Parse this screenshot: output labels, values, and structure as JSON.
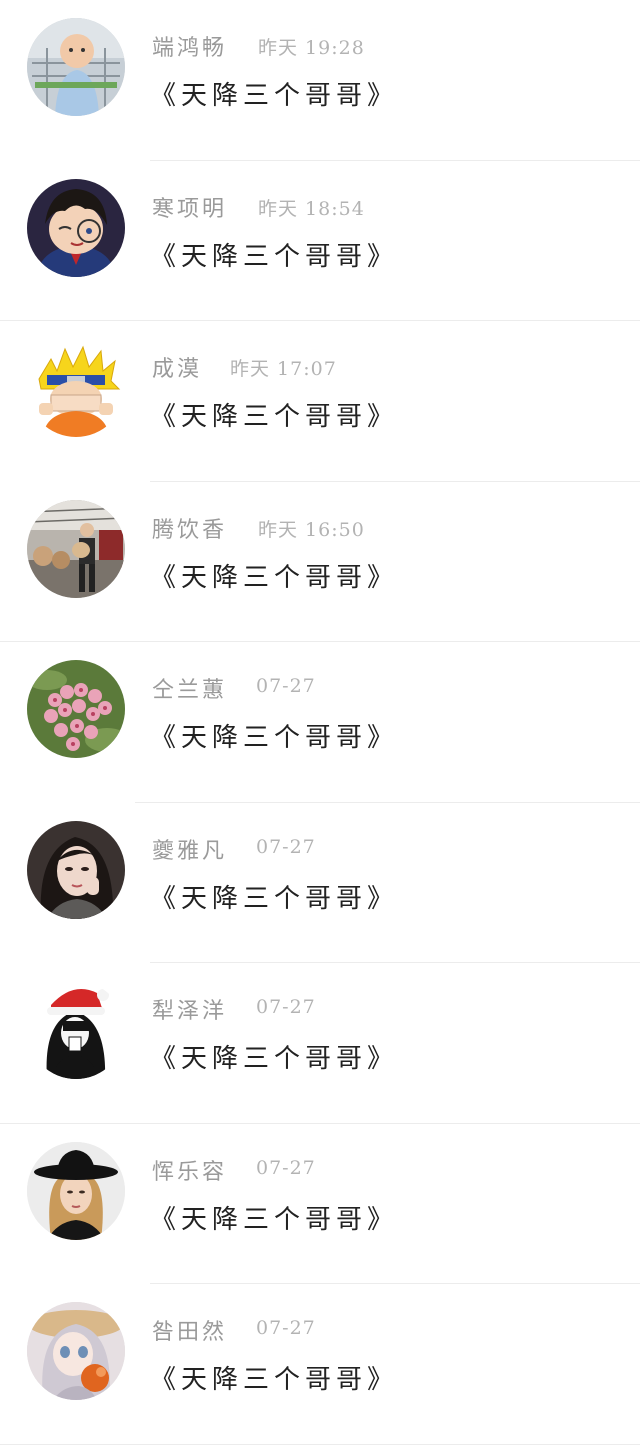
{
  "conversations": [
    {
      "name": "端鸿畅",
      "time": "昨天 19:28",
      "message": "《天降三个哥哥》",
      "avatar": "baby-photo-avatar"
    },
    {
      "name": "寒项明",
      "time": "昨天 18:54",
      "message": "《天降三个哥哥》",
      "avatar": "anime-detective-avatar"
    },
    {
      "name": "成漠",
      "time": "昨天 17:07",
      "message": "《天降三个哥哥》",
      "avatar": "anime-ninja-avatar"
    },
    {
      "name": "腾饮香",
      "time": "昨天 16:50",
      "message": "《天降三个哥哥》",
      "avatar": "musician-photo-avatar"
    },
    {
      "name": "仝兰蕙",
      "time": "07-27",
      "message": "《天降三个哥哥》",
      "avatar": "pink-flowers-avatar"
    },
    {
      "name": "夔雅凡",
      "time": "07-27",
      "message": "《天降三个哥哥》",
      "avatar": "woman-portrait-avatar"
    },
    {
      "name": "犁泽洋",
      "time": "07-27",
      "message": "《天降三个哥哥》",
      "avatar": "santa-hat-girl-avatar"
    },
    {
      "name": "恽乐容",
      "time": "07-27",
      "message": "《天降三个哥哥》",
      "avatar": "hat-model-avatar"
    },
    {
      "name": "咎田然",
      "time": "07-27",
      "message": "《天降三个哥哥》",
      "avatar": "anime-girl-avatar"
    }
  ]
}
